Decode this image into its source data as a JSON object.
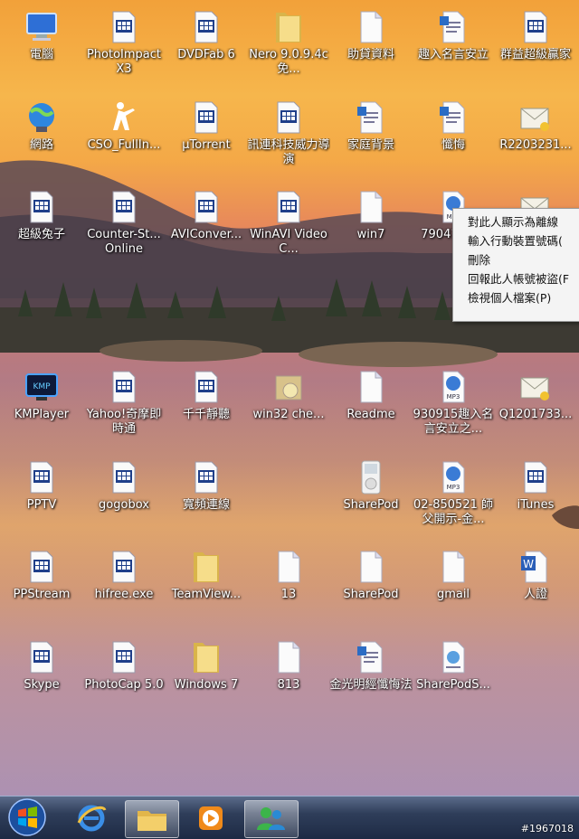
{
  "desktop_icons": [
    {
      "label": "電腦",
      "icon": "computer-icon"
    },
    {
      "label": "PhotoImpact X3",
      "icon": "app-icon"
    },
    {
      "label": "DVDFab 6",
      "icon": "app-icon"
    },
    {
      "label": "Nero 9.0.9.4c 免...",
      "icon": "folder-icon"
    },
    {
      "label": "助貸資料",
      "icon": "file-icon"
    },
    {
      "label": "趣入名言安立",
      "icon": "document-icon"
    },
    {
      "label": "群益超級贏家",
      "icon": "app-icon"
    },
    {
      "label": "網路",
      "icon": "network-icon"
    },
    {
      "label": "CSO_FullIn...",
      "icon": "cs-icon"
    },
    {
      "label": "µTorrent",
      "icon": "app-icon"
    },
    {
      "label": "訊連科技威力導演",
      "icon": "app-icon"
    },
    {
      "label": "家庭背景",
      "icon": "document-icon"
    },
    {
      "label": "懺悔",
      "icon": "document-icon"
    },
    {
      "label": "R2203231...",
      "icon": "mail-icon"
    },
    {
      "label": "超級兔子",
      "icon": "app-icon"
    },
    {
      "label": "Counter-St... Online",
      "icon": "app-icon"
    },
    {
      "label": "AVIConver...",
      "icon": "app-icon"
    },
    {
      "label": "WinAVI Video C...",
      "icon": "app-icon"
    },
    {
      "label": "win7",
      "icon": "file-icon"
    },
    {
      "label": "79041 3-秋",
      "icon": "mp3-icon"
    },
    {
      "label": "",
      "icon": "mail-icon"
    },
    {
      "label": "KMPlayer",
      "icon": "kmplayer-icon"
    },
    {
      "label": "Yahoo!奇摩即時通",
      "icon": "app-icon"
    },
    {
      "label": "千千靜聽",
      "icon": "app-icon"
    },
    {
      "label": "win32 che...",
      "icon": "installer-icon"
    },
    {
      "label": "Readme",
      "icon": "file-icon"
    },
    {
      "label": "930915趣入名言安立之...",
      "icon": "mp3-icon"
    },
    {
      "label": "Q1201733...",
      "icon": "mail-icon"
    },
    {
      "label": "PPTV",
      "icon": "app-icon"
    },
    {
      "label": "gogobox",
      "icon": "app-icon"
    },
    {
      "label": "寬頻連線",
      "icon": "app-icon"
    },
    {
      "label": "",
      "icon": "none"
    },
    {
      "label": "SharePod",
      "icon": "ipod-icon"
    },
    {
      "label": "02-850521 師父開示-金...",
      "icon": "mp3-icon"
    },
    {
      "label": "iTunes",
      "icon": "app-icon"
    },
    {
      "label": "PPStream",
      "icon": "app-icon"
    },
    {
      "label": "hifree.exe",
      "icon": "app-icon"
    },
    {
      "label": "TeamView...",
      "icon": "folder-icon"
    },
    {
      "label": "13",
      "icon": "file-icon"
    },
    {
      "label": "SharePod",
      "icon": "file-icon"
    },
    {
      "label": "gmail",
      "icon": "file-icon"
    },
    {
      "label": "人證",
      "icon": "word-icon"
    },
    {
      "label": "Skype",
      "icon": "app-icon"
    },
    {
      "label": "PhotoCap 5.0",
      "icon": "app-icon"
    },
    {
      "label": "Windows 7",
      "icon": "folder-icon"
    },
    {
      "label": "813",
      "icon": "file-icon"
    },
    {
      "label": "金光明經懺悔法",
      "icon": "document-icon"
    },
    {
      "label": "SharePodS...",
      "icon": "html-icon"
    },
    {
      "label": "",
      "icon": "none"
    }
  ],
  "context_menu": {
    "items": [
      "對此人顯示為離線",
      "輸入行動裝置號碼(",
      "刪除",
      "回報此人帳號被盜(F",
      "檢視個人檔案(P)"
    ]
  },
  "taskbar": {
    "items": [
      {
        "name": "ie-taskbar-button",
        "icon": "ie-icon"
      },
      {
        "name": "explorer-taskbar-button",
        "icon": "folder-icon"
      },
      {
        "name": "media-player-taskbar-button",
        "icon": "media-player-icon"
      },
      {
        "name": "messenger-taskbar-button",
        "icon": "messenger-icon"
      }
    ]
  },
  "watermark": "#1967018"
}
